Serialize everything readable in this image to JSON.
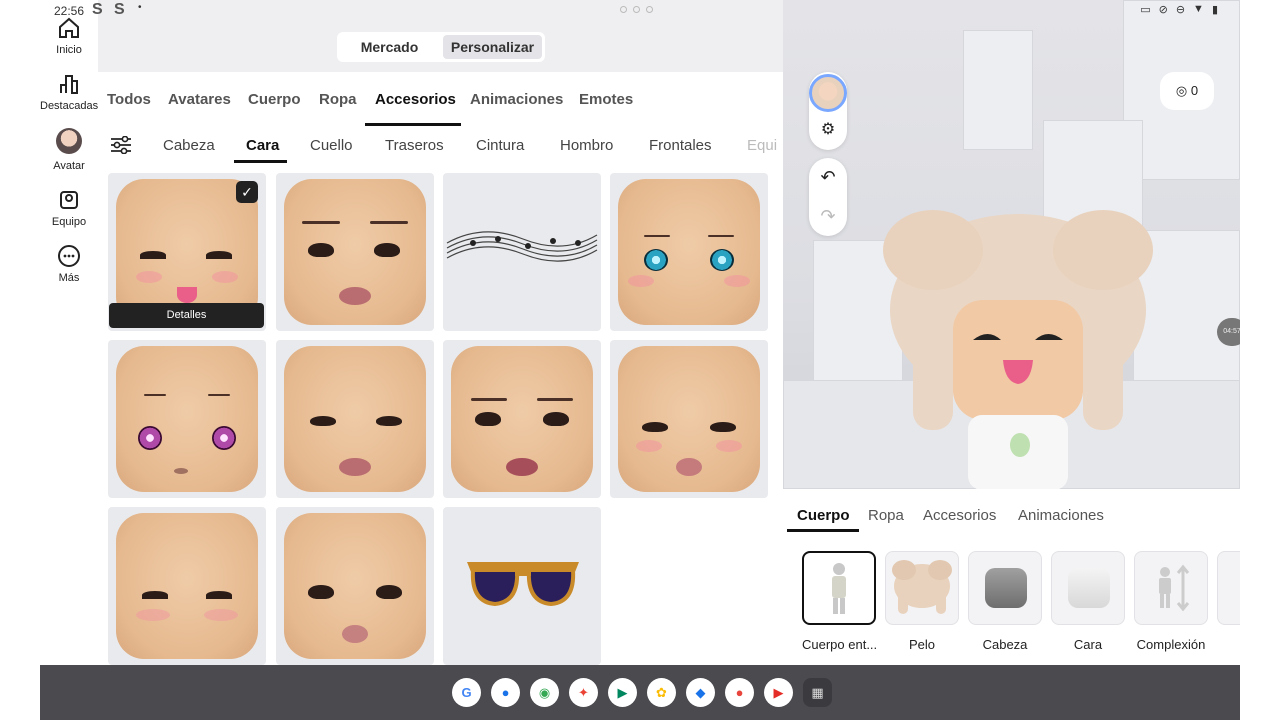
{
  "status_bar": {
    "time": "22:56",
    "symbols": [
      "S",
      "S"
    ]
  },
  "sidenav": {
    "items": [
      {
        "label": "Inicio"
      },
      {
        "label": "Destacadas"
      },
      {
        "label": "Avatar"
      },
      {
        "label": "Equipo"
      },
      {
        "label": "Más"
      }
    ]
  },
  "segmented": {
    "options": [
      "Mercado",
      "Personalizar"
    ],
    "selected": "Personalizar"
  },
  "category_tabs": {
    "items": [
      "Todos",
      "Avatares",
      "Cuerpo",
      "Ropa",
      "Accesorios",
      "Animaciones",
      "Emotes"
    ],
    "selected": "Accesorios"
  },
  "subcategory_tabs": {
    "items": [
      "Cabeza",
      "Cara",
      "Cuello",
      "Traseros",
      "Cintura",
      "Hombro",
      "Frontales",
      "Equi"
    ],
    "selected": "Cara"
  },
  "grid": {
    "details_label": "Detalles",
    "check_glyph": "✓"
  },
  "scene": {
    "robux_count": "0",
    "timer_label": "04:57"
  },
  "panel": {
    "tabs": [
      "Cuerpo",
      "Ropa",
      "Accesorios",
      "Animaciones"
    ],
    "selected_tab": "Cuerpo",
    "items": [
      {
        "label": "Cuerpo ent..."
      },
      {
        "label": "Pelo"
      },
      {
        "label": "Cabeza"
      },
      {
        "label": "Cara"
      },
      {
        "label": "Complexión"
      }
    ]
  },
  "dock": {
    "apps": [
      {
        "name": "google-icon",
        "glyph": "G",
        "color": "#4285F4"
      },
      {
        "name": "messages-icon",
        "glyph": "●",
        "color": "#1a73e8"
      },
      {
        "name": "chrome-icon",
        "glyph": "◉",
        "color": "#34A853"
      },
      {
        "name": "assistant-icon",
        "glyph": "✦",
        "color": "#EA4335"
      },
      {
        "name": "play-store-icon",
        "glyph": "▶",
        "color": "#01875f"
      },
      {
        "name": "photos-icon",
        "glyph": "✿",
        "color": "#FBBC05"
      },
      {
        "name": "roblox-icon",
        "glyph": "◆",
        "color": "#1a73e8"
      },
      {
        "name": "recorder-icon",
        "glyph": "●",
        "color": "#e8453c"
      },
      {
        "name": "youtube-icon",
        "glyph": "▶",
        "color": "#e52d27"
      },
      {
        "name": "app-grid-icon",
        "glyph": "▦",
        "color": "#333333"
      }
    ]
  }
}
